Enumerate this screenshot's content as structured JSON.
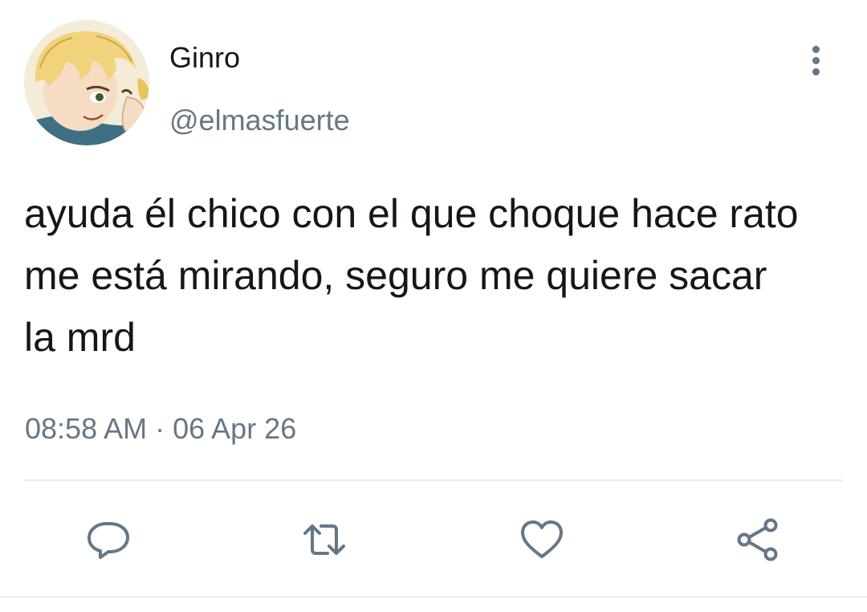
{
  "tweet": {
    "display_name": "Ginro",
    "handle": "@elmasfuerte",
    "text": "ayuda él chico con el que choque hace rato\nme está mirando, seguro me quiere sacar\nla mrd",
    "timestamp": "08:58 AM · 06 Apr 26"
  },
  "icons": {
    "more": "more-vertical-icon",
    "reply": "reply-icon",
    "retweet": "retweet-icon",
    "like": "heart-icon",
    "share": "share-icon"
  },
  "colors": {
    "text_primary": "#14171a",
    "text_secondary": "#657786",
    "divider": "#e6ecf0"
  }
}
